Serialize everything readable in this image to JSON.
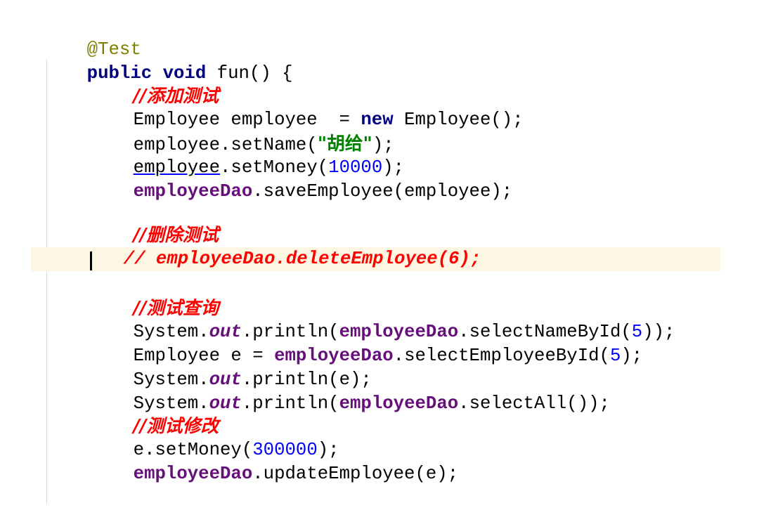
{
  "code": {
    "annotation": "@Test",
    "kw_public": "public",
    "kw_void": "void",
    "method_sig": " fun() {",
    "comment_add": "//添加测试",
    "l_new_a": "Employee employee  = ",
    "kw_new": "new",
    "l_new_b": " Employee();",
    "l_setname_a": "employee.setName(",
    "str_name": "\"胡给\"",
    "l_setname_b": ");",
    "var_employee": "employee",
    "l_setmoney_a": ".setMoney(",
    "num_10000": "10000",
    "l_setmoney_b": ");",
    "dao": "employeeDao",
    "l_save": ".saveEmployee(employee);",
    "comment_delete": "//删除测试",
    "commented_delete": "// employeeDao.deleteEmployee(6);",
    "comment_query": "//测试查询",
    "system": "System.",
    "out": "out",
    "println_open": ".println(",
    "l_select_name_a": ".selectNameById(",
    "num_5": "5",
    "l_close2": "));",
    "l_emp_e_a": "Employee e = ",
    "l_select_emp_a": ".selectEmployeeById(",
    "l_close1": ");",
    "l_print_e": ".println(e);",
    "l_select_all": ".selectAll());",
    "comment_update": "//测试修改",
    "l_e_setmoney": "e.setMoney(",
    "num_300000": "300000",
    "l_update": ".updateEmployee(e);"
  }
}
